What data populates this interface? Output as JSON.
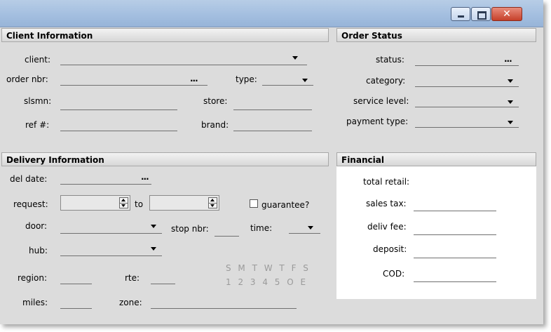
{
  "window": {
    "buttons": {
      "minimize": "minimize",
      "maximize": "maximize",
      "close": "close"
    }
  },
  "client": {
    "header": "Client Information",
    "client_label": "client:",
    "order_label": "order nbr:",
    "type_label": "type:",
    "slsmn_label": "slsmn:",
    "store_label": "store:",
    "ref_label": "ref #:",
    "brand_label": "brand:",
    "ellipsis": "..."
  },
  "order": {
    "header": "Order Status",
    "status_label": "status:",
    "category_label": "category:",
    "service_label": "service level:",
    "payment_label": "payment type:",
    "ellipsis": "..."
  },
  "delivery": {
    "header": "Delivery Information",
    "del_date_label": "del date:",
    "request_label": "request:",
    "to_label": "to",
    "guarantee_label": "guarantee?",
    "door_label": "door:",
    "stop_label": "stop nbr:",
    "time_label": "time:",
    "hub_label": "hub:",
    "region_label": "region:",
    "rte_label": "rte:",
    "miles_label": "miles:",
    "zone_label": "zone:",
    "days_top": "S M T W T F S",
    "days_bottom": "1 2 3 4 5 O E",
    "ellipsis": "..."
  },
  "financial": {
    "header": "Financial",
    "total_label": "total retail:",
    "tax_label": "sales tax:",
    "fee_label": "deliv fee:",
    "deposit_label": "deposit:",
    "cod_label": "COD:"
  }
}
